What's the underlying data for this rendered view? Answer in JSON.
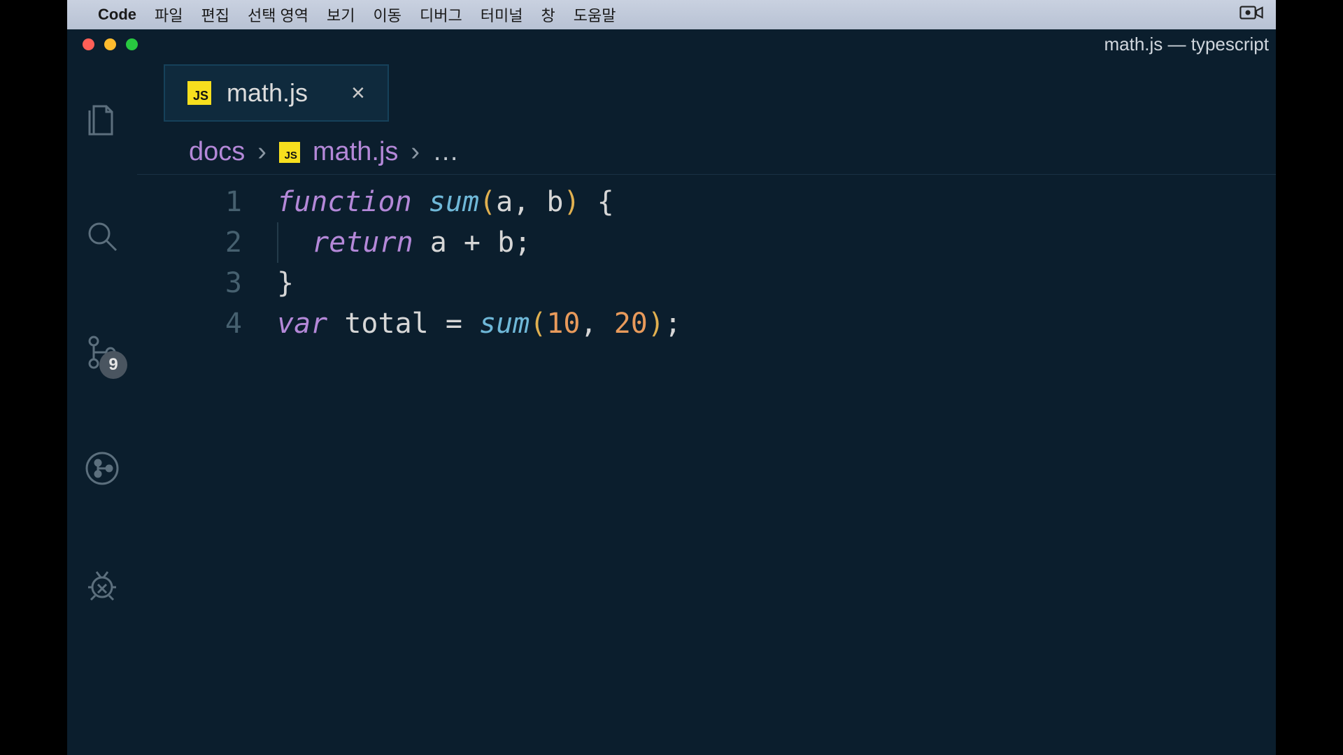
{
  "menubar": {
    "app": "Code",
    "items": [
      "파일",
      "편집",
      "선택 영역",
      "보기",
      "이동",
      "디버그",
      "터미널",
      "창",
      "도움말"
    ]
  },
  "window": {
    "title": "math.js — typescript"
  },
  "activitybar": {
    "scm_badge": "9"
  },
  "tab": {
    "icon_label": "JS",
    "filename": "math.js",
    "close": "×"
  },
  "breadcrumb": {
    "folder": "docs",
    "icon_label": "JS",
    "file": "math.js",
    "ellipsis": "…"
  },
  "editor": {
    "line_numbers": [
      "1",
      "2",
      "3",
      "4"
    ],
    "code": {
      "l1": {
        "kw": "function",
        "fn": "sum",
        "paren_open": "(",
        "args": "a, b",
        "paren_close": ")",
        "brace": " {"
      },
      "l2": {
        "kw": "return",
        "expr": " a + b;"
      },
      "l3": {
        "brace": "}"
      },
      "l4": {
        "kw": "var",
        "name": " total ",
        "eq": "= ",
        "fn": "sum",
        "paren_open": "(",
        "n1": "10",
        "comma": ", ",
        "n2": "20",
        "paren_close": ")",
        "semi": ";"
      }
    }
  }
}
